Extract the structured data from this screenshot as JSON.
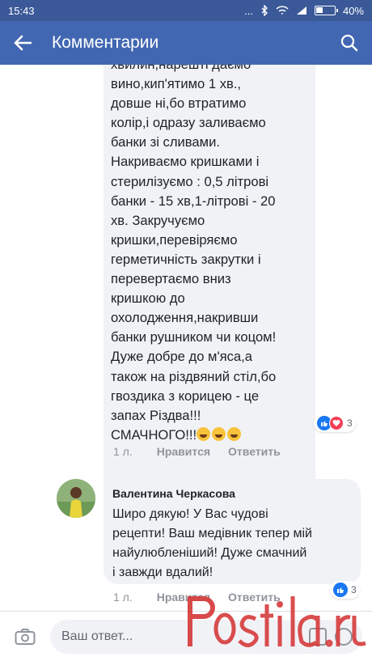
{
  "status_bar": {
    "time": "15:43",
    "battery": "40%",
    "indicators": "..."
  },
  "app_bar": {
    "title": "Комментарии",
    "back_icon": "arrow-left-icon",
    "search_icon": "search-icon"
  },
  "comments": [
    {
      "partial_first_line": "хвилин,нарешті даємо",
      "text": "вино,кип'ятимо 1 хв.,\nдовше ні,бо втратимо\nколір,і одразу заливаємо\nбанки зі сливами.\nНакриваємо кришками і\nстерилізуємо : 0,5 літрові\nбанки - 15 хв,1-літрові - 20\nхв. Закручуємо\nкришки,перевіряємо\nгерметичність закрутки і\nперевертаємо вниз\nкришкою до\nохолодження,накривши\nбанки рушником чи коцом!\nДуже добре до м'яса,а\nтакож на різдвяний стіл,бо\nгвоздика з корицею - це\nзапах Різдва!!!",
      "last_line": "СМАЧНОГО!!!",
      "emoji_count": 3,
      "reactions": {
        "icons": [
          "like-icon",
          "love-icon"
        ],
        "count": "3"
      },
      "meta": {
        "time": "1 л.",
        "like": "Нравится",
        "reply": "Ответить"
      }
    },
    {
      "author": "Валентина Черкасова",
      "text": "Широ дякую! У Вас чудові\nрецепти! Ваш медівник тепер мій\nнайулюбленіший! Дуже смачний\nі завжди вдалий!",
      "reactions": {
        "icons": [
          "like-icon"
        ],
        "count": "3"
      },
      "meta": {
        "time": "1 л.",
        "like": "Нравится",
        "reply": "Ответить"
      }
    }
  ],
  "composer": {
    "placeholder": "Ваш ответ..."
  },
  "watermark": "postila.ru",
  "colors": {
    "status_bar": "#3b5998",
    "app_bar": "#4267b2",
    "bubble": "#f1f2f6",
    "meta": "#90949c"
  }
}
